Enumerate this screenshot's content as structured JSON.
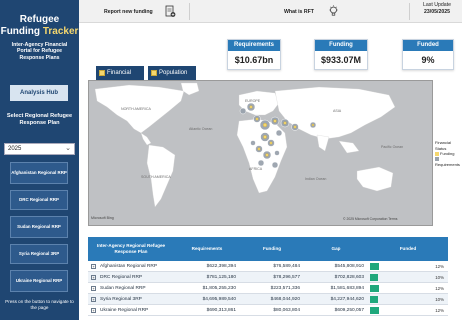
{
  "sidebar": {
    "brand_line1": "Refugee",
    "brand_line2a": "Funding ",
    "brand_line2b": "Tracker",
    "portal_subtitle": "Inter-Agency Financial Portal for Refugee Response Plans",
    "analysis_hub": "Analysis Hub",
    "select_label": "Select Regional Refugee Response Plan",
    "year_value": "2025",
    "plans": [
      "Afghanistan Regional RRP",
      "DRC Regional RRP",
      "Sudan Regional RRP",
      "Syria Regional 3RP",
      "Ukraine Regional RRP"
    ],
    "press_note": "Press on the button to navigate to the page"
  },
  "topbar": {
    "report_funding": "Report new funding",
    "what_is_rft": "What is RFT",
    "last_update_label": "Last Update",
    "last_update_date": "23/05/2025"
  },
  "kpis": {
    "requirements_label": "Requirements",
    "requirements_value": "$10.67bn",
    "funding_label": "Funding",
    "funding_value": "$933.07M",
    "funded_label": "Funded",
    "funded_value": "9%"
  },
  "tabs": {
    "financial": "Financial",
    "population": "Population"
  },
  "map": {
    "labels": {
      "north_america": "NORTH AMERICA",
      "south_america": "SOUTH AMERICA",
      "europe": "EUROPE",
      "asia": "ASIA",
      "africa": "AFRICA",
      "atlantic": "Atlantic Ocean",
      "pacific": "Pacific Ocean",
      "indian": "Indian Ocean"
    },
    "legend_title": "Financial Status",
    "legend_funding": "Funding",
    "legend_requirements": "Requirements",
    "bing": "Microsoft Bing",
    "copyright": "© 2025 Microsoft Corporation  Terms",
    "colors": {
      "funding": "#f5d76e",
      "requirements": "#9aa3ad"
    }
  },
  "table": {
    "headers": {
      "plan": "Inter-Agency Regional Refugee Response Plan",
      "requirements": "Requirements",
      "funding": "Funding",
      "gap": "Gap",
      "funded": "Funded"
    },
    "rows": [
      {
        "plan": "Afghanistan Regional RRP",
        "requirements": "$622,398,394",
        "funding": "$76,589,484",
        "gap": "$545,808,910",
        "funded_pct": 12,
        "funded_label": "12%"
      },
      {
        "plan": "DRC Regional RRP",
        "requirements": "$781,125,180",
        "funding": "$78,296,577",
        "gap": "$702,828,603",
        "funded_pct": 10,
        "funded_label": "10%"
      },
      {
        "plan": "Sudan Regional RRP",
        "requirements": "$1,805,255,230",
        "funding": "$223,571,336",
        "gap": "$1,581,683,894",
        "funded_pct": 12,
        "funded_label": "12%"
      },
      {
        "plan": "Syria Regional 3RP",
        "requirements": "$4,695,989,540",
        "funding": "$468,044,920",
        "gap": "$4,227,944,620",
        "funded_pct": 10,
        "funded_label": "10%"
      },
      {
        "plan": "Ukraine Regional RRP",
        "requirements": "$690,313,861",
        "funding": "$80,063,804",
        "gap": "$609,250,057",
        "funded_pct": 12,
        "funded_label": "12%"
      }
    ]
  }
}
